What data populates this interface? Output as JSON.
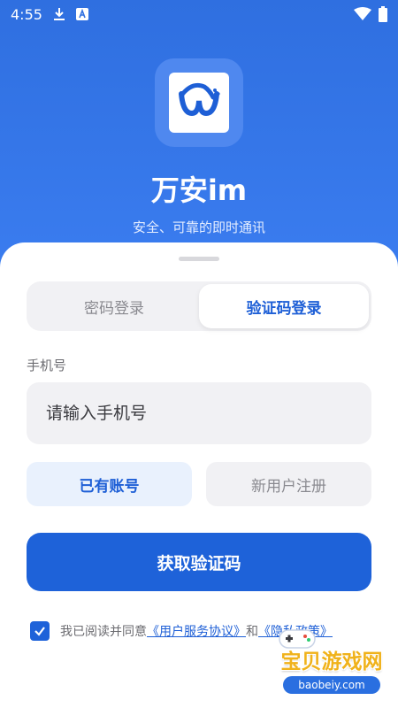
{
  "status_bar": {
    "time": "4:55",
    "icons": [
      "download-icon",
      "font-a-icon",
      "wifi-icon",
      "battery-icon"
    ]
  },
  "app": {
    "name": "万安im",
    "slogan": "安全、可靠的即时通讯",
    "logo_icon": "wave-w-logo"
  },
  "tabs": [
    {
      "label": "密码登录",
      "active": false
    },
    {
      "label": "验证码登录",
      "active": true
    }
  ],
  "form": {
    "phone_label": "手机号",
    "phone_placeholder": "请输入手机号",
    "phone_value": ""
  },
  "account_buttons": {
    "existing": "已有账号",
    "new_user": "新用户注册"
  },
  "primary_button": "获取验证码",
  "agreement": {
    "checked": true,
    "prefix": "我已阅读并同意",
    "terms_link": "《用户服务协议》",
    "conjunction": "和",
    "privacy_link": "《隐私政策》"
  },
  "watermark": {
    "title": "宝贝游戏网",
    "url": "baobeiy.com"
  },
  "colors": {
    "primary": "#1e62d9",
    "header_gradient_top": "#2f6fe0",
    "accent_text": "#1e5fd6",
    "field_bg": "#f1f1f4"
  }
}
